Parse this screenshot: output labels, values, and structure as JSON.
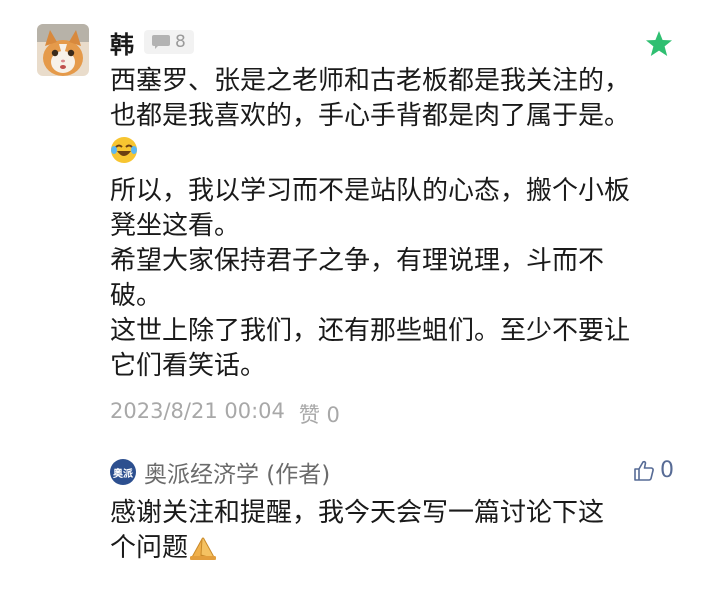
{
  "comment": {
    "author": "韩",
    "reply_count": "8",
    "body_lines": [
      "西塞罗、张是之老师和古老板都是我关注的，也都是我喜欢的，手心手背都是肉了属于是。",
      "所以，我以学习而不是站队的心态，搬个小板凳坐这看。",
      "希望大家保持君子之争，有理说理，斗而不破。",
      "这世上除了我们，还有那些蛆们。至少不要让它们看笑话。"
    ],
    "emoji_icon": "laughing-tears-emoji",
    "date": "2023/8/21 00:04",
    "like_label": "赞 0",
    "star_color": "#2fbf71"
  },
  "reply": {
    "author": "奥派经济学 (作者)",
    "logo_text": "奥派",
    "like_count": "0",
    "text_lines": [
      "感谢关注和提醒，我今天会写一篇讨论下这个问题"
    ],
    "emoji_icon": "praying-hands-emoji",
    "link_color": "#576b95"
  }
}
